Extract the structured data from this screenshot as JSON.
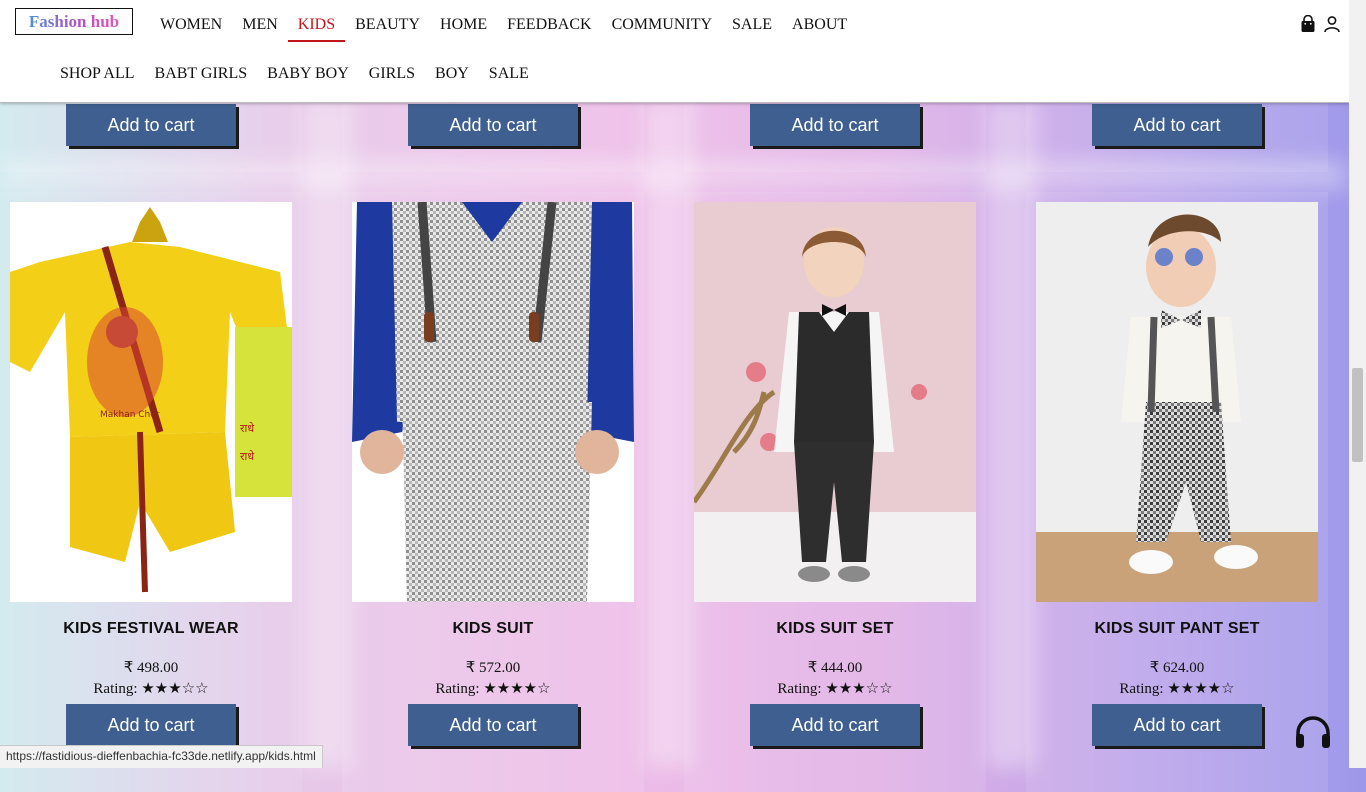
{
  "brand": "Fashion hub",
  "nav": {
    "main": [
      "WOMEN",
      "MEN",
      "KIDS",
      "BEAUTY",
      "HOME",
      "FEEDBACK",
      "COMMUNITY",
      "SALE",
      "ABOUT"
    ],
    "active": "KIDS",
    "sub": [
      "SHOP ALL",
      "BABT GIRLS",
      "BABY BOY",
      "GIRLS",
      "BOY",
      "SALE"
    ]
  },
  "header_icons": [
    "shopping-bag-icon",
    "user-icon"
  ],
  "previous_row": {
    "button_label": "Add to cart"
  },
  "products": [
    {
      "name": "KIDS FESTIVAL WEAR",
      "price": "₹ 498.00",
      "rating_label": "Rating:",
      "stars": "★★★☆☆",
      "rating": 3,
      "button": "Add to cart"
    },
    {
      "name": "KIDS SUIT",
      "price": "₹ 572.00",
      "rating_label": "Rating:",
      "stars": "★★★★☆",
      "rating": 4,
      "button": "Add to cart"
    },
    {
      "name": "KIDS SUIT SET",
      "price": "₹ 444.00",
      "rating_label": "Rating:",
      "stars": "★★★☆☆",
      "rating": 3,
      "button": "Add to cart"
    },
    {
      "name": "KIDS SUIT PANT SET",
      "price": "₹ 624.00",
      "rating_label": "Rating:",
      "stars": "★★★★☆",
      "rating": 4,
      "button": "Add to cart"
    }
  ],
  "status_url": "https://fastidious-dieffenbachia-fc33de.netlify.app/kids.html",
  "colors": {
    "accent": "#c3151b",
    "button": "#3e5f8f"
  }
}
